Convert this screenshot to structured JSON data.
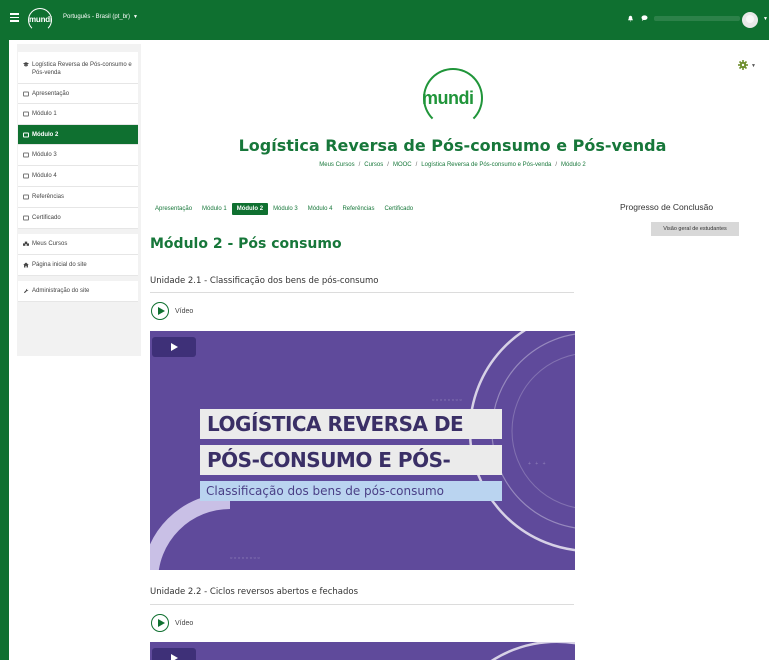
{
  "topbar": {
    "logo_text": "mundi",
    "language": "Português - Brasil (pt_br)"
  },
  "drawer": {
    "items": [
      {
        "label": "Logística Reversa de Pós-consumo e Pós-venda",
        "icon": "graduation-cap-icon"
      },
      {
        "label": "Apresentação",
        "icon": "folder-icon"
      },
      {
        "label": "Módulo 1",
        "icon": "folder-icon"
      },
      {
        "label": "Módulo 2",
        "icon": "folder-icon",
        "active": true
      },
      {
        "label": "Módulo 3",
        "icon": "folder-icon"
      },
      {
        "label": "Módulo 4",
        "icon": "folder-icon"
      },
      {
        "label": "Referências",
        "icon": "folder-icon"
      },
      {
        "label": "Certificado",
        "icon": "folder-icon"
      },
      {
        "label": "Meus Cursos",
        "icon": "cubes-icon"
      },
      {
        "label": "Página inicial do site",
        "icon": "home-icon"
      },
      {
        "label": "Administração do site",
        "icon": "wrench-icon"
      }
    ]
  },
  "course": {
    "logo_text": "mundi",
    "title": "Logística Reversa de Pós-consumo e Pós-venda",
    "breadcrumb": [
      "Meus Cursos",
      "Cursos",
      "MOOC",
      "Logística Reversa de Pós-consumo e Pós-venda",
      "Módulo 2"
    ]
  },
  "tabs": [
    {
      "label": "Apresentação"
    },
    {
      "label": "Módulo 1"
    },
    {
      "label": "Módulo 2",
      "active": true
    },
    {
      "label": "Módulo 3"
    },
    {
      "label": "Módulo 4"
    },
    {
      "label": "Referências"
    },
    {
      "label": "Certificado"
    }
  ],
  "progress": {
    "title": "Progresso de Conclusão",
    "overview_button": "Visão geral de estudantes"
  },
  "module": {
    "title": "Módulo 2 - Pós consumo",
    "units": [
      {
        "title": "Unidade 2.1 - Classificação dos bens de pós-consumo",
        "activity_label": "Vídeo",
        "thumb_line1": "LOGÍSTICA REVERSA DE",
        "thumb_line2": "PÓS-CONSUMO E PÓS-VENDA",
        "thumb_subtitle": "Classificação dos bens de pós-consumo"
      },
      {
        "title": "Unidade 2.2 - Ciclos reversos abertos e fechados",
        "activity_label": "Vídeo"
      }
    ]
  },
  "colors": {
    "brand_green": "#0f7030",
    "accent_green": "#20953a",
    "video_purple": "#5f4a9b"
  }
}
